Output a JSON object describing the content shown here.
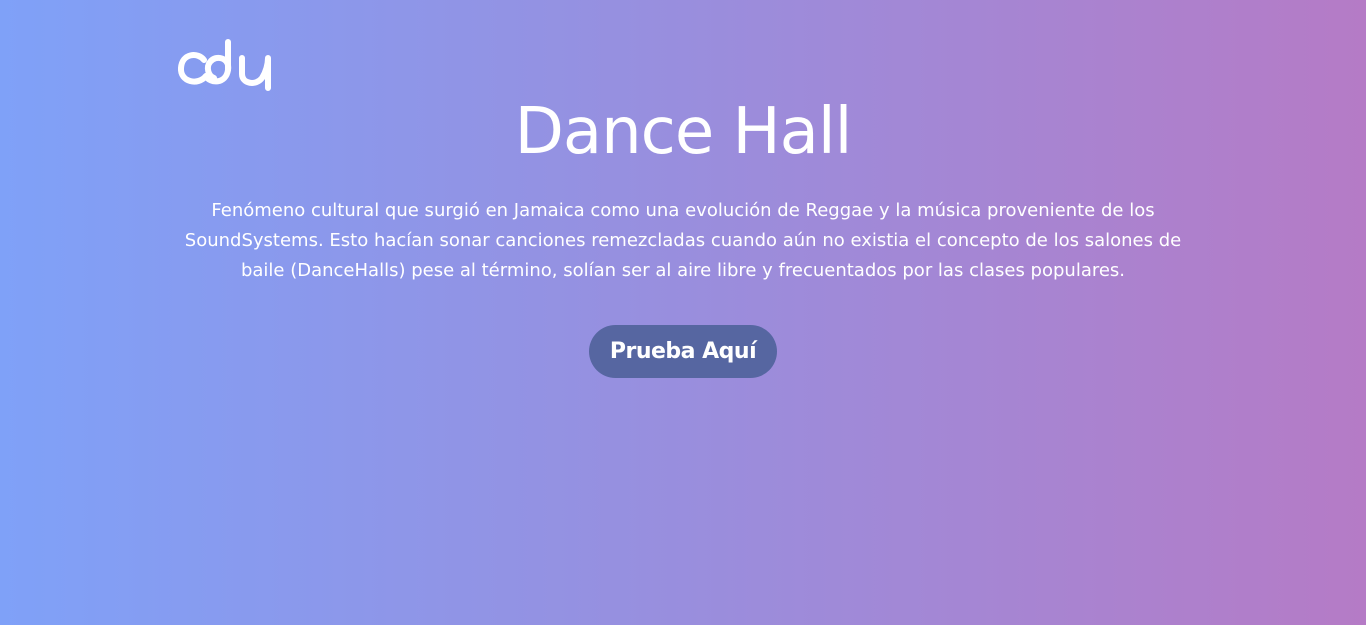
{
  "logo": {
    "icon": "dance-hall-logo-icon"
  },
  "hero": {
    "title": "Dance Hall",
    "description": "Fenómeno cultural que surgió en Jamaica como una evolución de Reggae y la música proveniente de los SoundSystems. Esto hacían sonar canciones remezcladas cuando aún no existia el concepto de los salones de baile (DanceHalls) pese al término, solían ser al aire libre y frecuentados por las clases populares.",
    "cta_label": "Prueba Aquí"
  },
  "colors": {
    "gradient_start": "#7fa1f8",
    "gradient_end": "#b57bc6",
    "button_bg": "#5666a1",
    "text": "#ffffff"
  }
}
